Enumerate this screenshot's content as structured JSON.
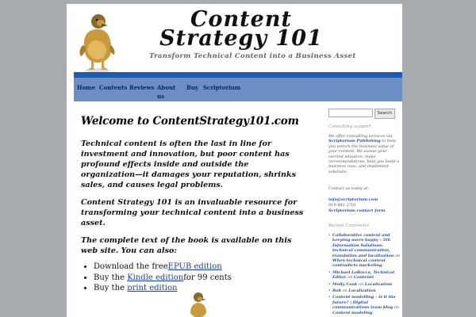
{
  "header": {
    "title": "Content Strategy 101",
    "tagline": "Transform Technical Content into a Business Asset"
  },
  "nav": {
    "items": [
      {
        "label": "Home"
      },
      {
        "label": "Contents"
      },
      {
        "label": "Reviews"
      },
      {
        "label": "About us"
      },
      {
        "label": "Buy"
      },
      {
        "label": "Scriptorium"
      }
    ]
  },
  "main": {
    "title": "Welcome to ContentStrategy101.com",
    "p1": "Technical content is often the last in line for investment and innovation, but poor content has profound effects inside and outside the organization—it damages your reputation, shrinks sales, and causes legal problems.",
    "p2": "Content Strategy 101 is an invaluable resource for transforming your technical content into a business asset.",
    "p3": "The complete text of the book is available on this web site. You can also:",
    "editions": [
      {
        "before": "Download the free",
        "link": "EPUB edition",
        "after": ""
      },
      {
        "before": "Buy the ",
        "link": "Kindle edition",
        "after": "for 99 cents"
      },
      {
        "before": "Buy the ",
        "link": "print edition",
        "after": ""
      }
    ]
  },
  "sidebar": {
    "search_button": "Search",
    "search_value": "",
    "consulting_heading": "Consulting support",
    "consulting_text_before": "We offer consulting services via ",
    "consulting_link": "Scriptorium Publishing",
    "consulting_text_after": " to help you unlock the business value of your content. We assess your current situation, make recommendations, help you build a business case, and implement solutions.",
    "contact_line": "Contact us today at:",
    "contact_email": "info@scriptorium.com",
    "contact_phone": "919-481-2701",
    "contact_form": "Scriptorium contact form",
    "recent_heading": "Recent Comments",
    "recent_comments": [
      {
        "author": "Collaborative content and keeping users happy – 5th Information Solutions: technical communication, translation and localization",
        "on": "on",
        "post": "When technical content contradicts marketing"
      },
      {
        "author": "Michael LoRocca, Technical Editor",
        "on": "on",
        "post": "Contents"
      },
      {
        "author": "Molly Cook",
        "on": "on",
        "post": "Localization"
      },
      {
        "author": "Rob",
        "on": "on",
        "post": "Localization"
      },
      {
        "author": "Content modelling – is it the future? | Digital communications team blog",
        "on": "on",
        "post": "Content modeling"
      }
    ]
  },
  "colors": {
    "nav_bar": "#6b8fc3",
    "nav_border": "#1c5bb4",
    "link": "#1a3f9a",
    "background": "#a7abaf"
  }
}
